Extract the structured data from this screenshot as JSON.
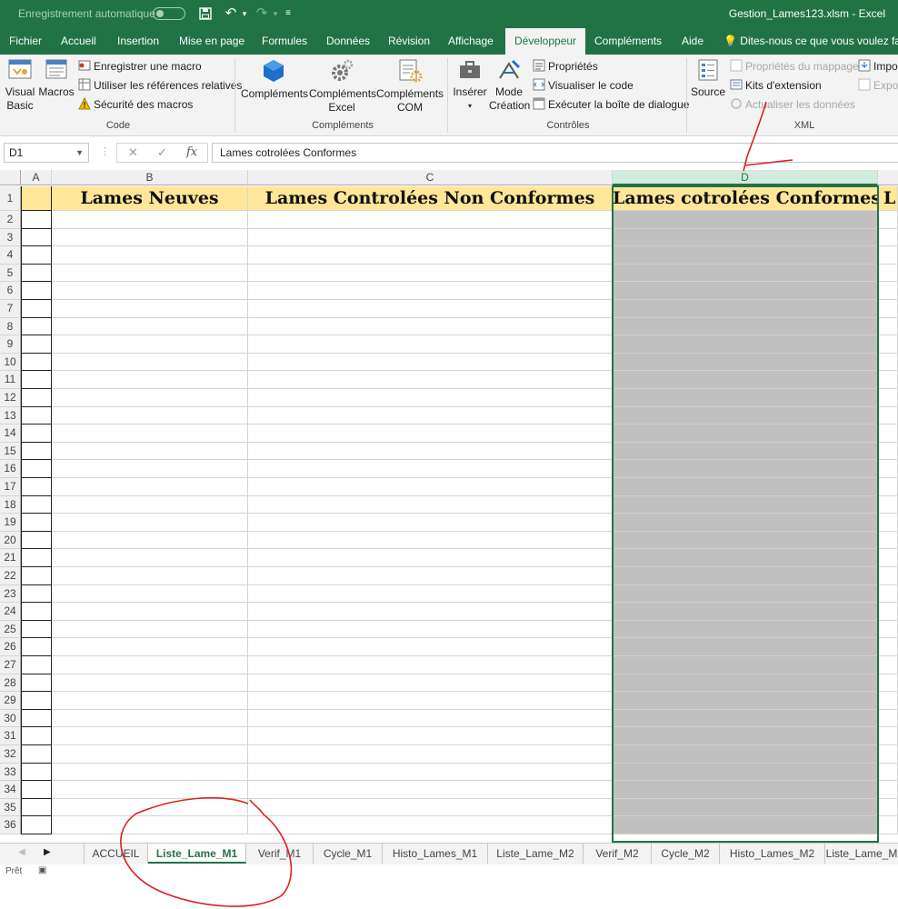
{
  "titlebar": {
    "autosave_label": "Enregistrement automatique",
    "file_title": "Gestion_Lames123.xlsm  -  Excel"
  },
  "tabs": [
    {
      "label": "Fichier"
    },
    {
      "label": "Accueil"
    },
    {
      "label": "Insertion"
    },
    {
      "label": "Mise en page"
    },
    {
      "label": "Formules"
    },
    {
      "label": "Données"
    },
    {
      "label": "Révision"
    },
    {
      "label": "Affichage"
    },
    {
      "label": "Développeur",
      "active": true
    },
    {
      "label": "Compléments"
    },
    {
      "label": "Aide"
    }
  ],
  "tell_me": "Dites-nous ce que vous voulez faire",
  "ribbon": {
    "code": {
      "label": "Code",
      "visual_basic": "Visual\nBasic",
      "macros": "Macros",
      "record_macro": "Enregistrer une macro",
      "relative_refs": "Utiliser les références relatives",
      "macro_security": "Sécurité des macros"
    },
    "addins": {
      "label": "Compléments",
      "complements": "Compléments",
      "excel_addins": "Compléments\nExcel",
      "com_addins": "Compléments\nCOM"
    },
    "controls": {
      "label": "Contrôles",
      "insert": "Insérer",
      "design_mode": "Mode\nCréation",
      "properties": "Propriétés",
      "view_code": "Visualiser le code",
      "run_dialog": "Exécuter la boîte de dialogue"
    },
    "xml": {
      "label": "XML",
      "source": "Source",
      "map_properties": "Propriétés du mappage",
      "expansion_packs": "Kits d'extension",
      "refresh_data": "Actualiser les données",
      "import": "Impo",
      "export": "Expor"
    }
  },
  "formula_bar": {
    "name_box": "D1",
    "formula": "Lames cotrolées Conformes"
  },
  "columns": [
    "A",
    "B",
    "C",
    "D"
  ],
  "header_row": {
    "b1": "Lames Neuves",
    "c1": "Lames Controlées Non Conformes",
    "d1": "Lames cotrolées Conformes",
    "e1": "L"
  },
  "rows": [
    "1",
    "2",
    "3",
    "4",
    "5",
    "6",
    "7",
    "8",
    "9",
    "10",
    "11",
    "12",
    "13",
    "14",
    "15",
    "16",
    "17",
    "18",
    "19",
    "20",
    "21",
    "22",
    "23",
    "24",
    "25",
    "26",
    "27",
    "28",
    "29",
    "30",
    "31",
    "32",
    "33",
    "34",
    "35",
    "36"
  ],
  "sheet_tabs": [
    {
      "label": "ACCUEIL"
    },
    {
      "label": "Liste_Lame_M1",
      "active": true
    },
    {
      "label": "Verif_M1"
    },
    {
      "label": "Cycle_M1"
    },
    {
      "label": "Histo_Lames_M1"
    },
    {
      "label": "Liste_Lame_M2"
    },
    {
      "label": "Verif_M2"
    },
    {
      "label": "Cycle_M2"
    },
    {
      "label": "Histo_Lames_M2"
    },
    {
      "label": "Liste_Lame_M"
    }
  ],
  "status": "Prêt",
  "colors": {
    "accent": "#217346",
    "header_fill": "#ffe699",
    "selected_column_fill": "#c0c0c0",
    "annotation": "#e02020"
  }
}
